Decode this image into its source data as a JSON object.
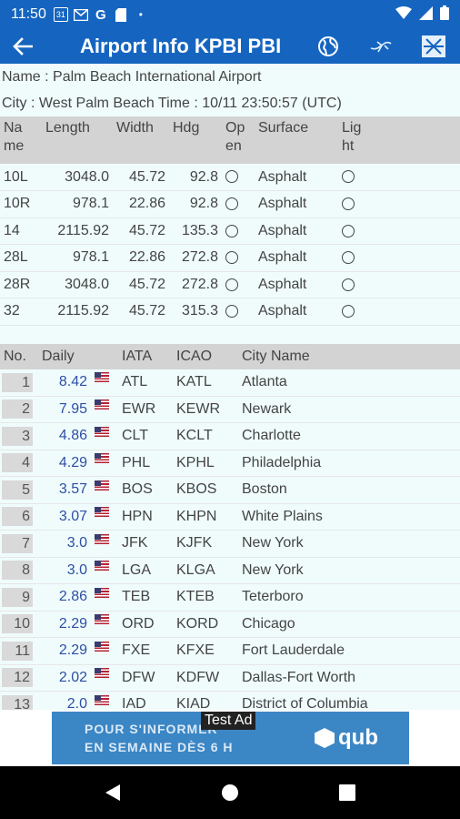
{
  "status": {
    "time": "11:50",
    "calendar_day": "31"
  },
  "appbar": {
    "title": "Airport Info KPBI PBI"
  },
  "info": {
    "name_label": "Name : ",
    "name_value": "Palm Beach International Airport",
    "city_label": "City : ",
    "city_value": "West Palm Beach",
    "time_label": " Time : ",
    "time_value": "10/11 23:50:57 (UTC)"
  },
  "runways": {
    "headers": {
      "name_l1": "Na",
      "name_l2": "me",
      "length": "Length",
      "width": "Width",
      "hdg": "Hdg",
      "open_l1": "Op",
      "open_l2": "en",
      "surface": "Surface",
      "light_l1": "Lig",
      "light_l2": "ht"
    },
    "rows": [
      {
        "name": "10L",
        "length": "3048.0",
        "width": "45.72",
        "hdg": "92.8",
        "surface": "Asphalt"
      },
      {
        "name": "10R",
        "length": "978.1",
        "width": "22.86",
        "hdg": "92.8",
        "surface": "Asphalt"
      },
      {
        "name": "14",
        "length": "2115.92",
        "width": "45.72",
        "hdg": "135.3",
        "surface": "Asphalt"
      },
      {
        "name": "28L",
        "length": "978.1",
        "width": "22.86",
        "hdg": "272.8",
        "surface": "Asphalt"
      },
      {
        "name": "28R",
        "length": "3048.0",
        "width": "45.72",
        "hdg": "272.8",
        "surface": "Asphalt"
      },
      {
        "name": "32",
        "length": "2115.92",
        "width": "45.72",
        "hdg": "315.3",
        "surface": "Asphalt"
      }
    ]
  },
  "destinations": {
    "headers": {
      "no": "No.",
      "daily": "Daily",
      "iata": "IATA",
      "icao": "ICAO",
      "city": "City Name"
    },
    "rows": [
      {
        "no": "1",
        "daily": "8.42",
        "iata": "ATL",
        "icao": "KATL",
        "city": "Atlanta"
      },
      {
        "no": "2",
        "daily": "7.95",
        "iata": "EWR",
        "icao": "KEWR",
        "city": "Newark"
      },
      {
        "no": "3",
        "daily": "4.86",
        "iata": "CLT",
        "icao": "KCLT",
        "city": "Charlotte"
      },
      {
        "no": "4",
        "daily": "4.29",
        "iata": "PHL",
        "icao": "KPHL",
        "city": "Philadelphia"
      },
      {
        "no": "5",
        "daily": "3.57",
        "iata": "BOS",
        "icao": "KBOS",
        "city": "Boston"
      },
      {
        "no": "6",
        "daily": "3.07",
        "iata": "HPN",
        "icao": "KHPN",
        "city": "White Plains"
      },
      {
        "no": "7",
        "daily": "3.0",
        "iata": "JFK",
        "icao": "KJFK",
        "city": "New York"
      },
      {
        "no": "8",
        "daily": "3.0",
        "iata": "LGA",
        "icao": "KLGA",
        "city": "New York"
      },
      {
        "no": "9",
        "daily": "2.86",
        "iata": "TEB",
        "icao": "KTEB",
        "city": "Teterboro"
      },
      {
        "no": "10",
        "daily": "2.29",
        "iata": "ORD",
        "icao": "KORD",
        "city": "Chicago"
      },
      {
        "no": "11",
        "daily": "2.29",
        "iata": "FXE",
        "icao": "KFXE",
        "city": "Fort Lauderdale"
      },
      {
        "no": "12",
        "daily": "2.02",
        "iata": "DFW",
        "icao": "KDFW",
        "city": "Dallas-Fort Worth"
      },
      {
        "no": "13",
        "daily": "2.0",
        "iata": "IAD",
        "icao": "KIAD",
        "city": "District of Columbia"
      }
    ]
  },
  "ad": {
    "label": "Test Ad",
    "line1": "POUR S'INFORMER",
    "line2": "EN SEMAINE DÈS 6 H",
    "brand": "qub"
  }
}
